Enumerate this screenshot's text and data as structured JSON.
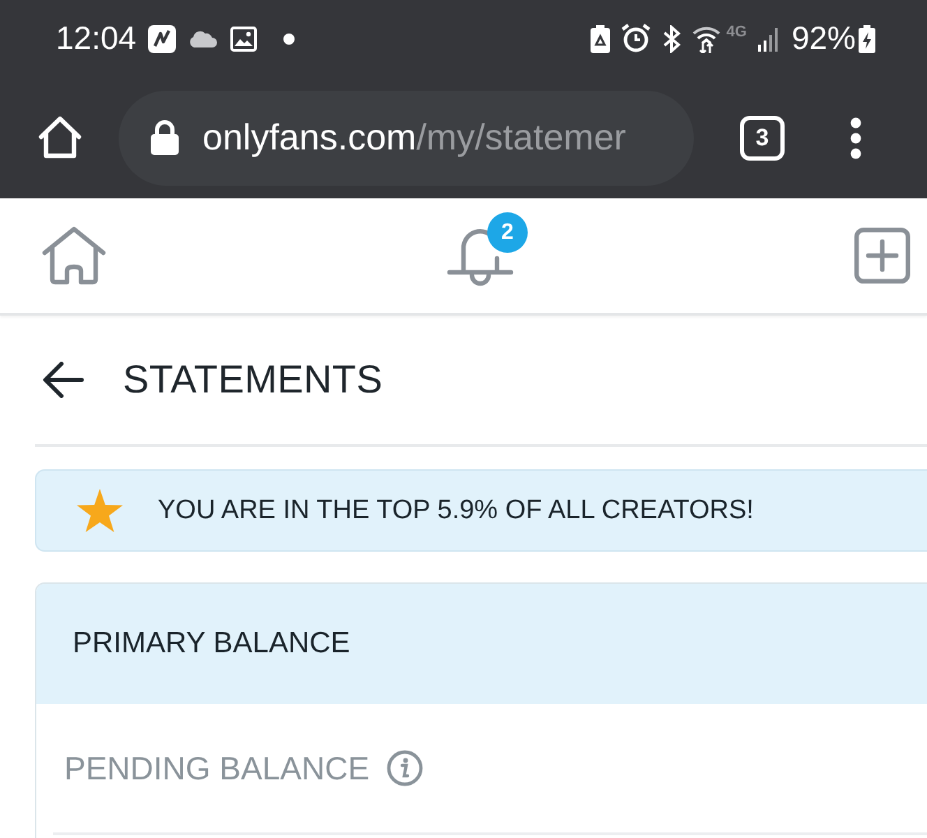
{
  "status_bar": {
    "time": "12:04",
    "network": "4G",
    "battery": "92%"
  },
  "browser": {
    "url_host": "onlyfans.com",
    "url_path": "/my/statemer",
    "tab_count": "3"
  },
  "nav": {
    "notification_count": "2"
  },
  "page": {
    "title": "STATEMENTS"
  },
  "banner": {
    "text": "YOU ARE IN THE TOP 5.9% OF ALL CREATORS!"
  },
  "card": {
    "title": "PRIMARY BALANCE",
    "rows": [
      {
        "label": "PENDING BALANCE"
      }
    ]
  }
}
